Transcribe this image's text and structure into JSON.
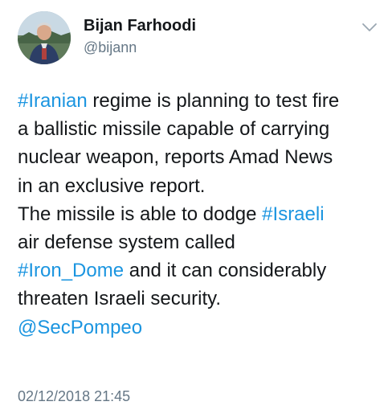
{
  "author": {
    "display_name": "Bijan Farhoodi",
    "handle": "@bijann"
  },
  "icons": {
    "avatar": "profile-photo",
    "menu": "chevron-down-icon"
  },
  "colors": {
    "link": "#1b95e0",
    "text": "#14171a",
    "muted": "#657786"
  },
  "tweet": {
    "lines": [
      [
        {
          "text": "#Iranian",
          "link": true
        },
        {
          "text": " regime is planning to test fire",
          "link": false
        }
      ],
      [
        {
          "text": "a ballistic missile capable of carrying",
          "link": false
        }
      ],
      [
        {
          "text": "nuclear weapon, reports Amad News",
          "link": false
        }
      ],
      [
        {
          "text": "in an exclusive report.",
          "link": false
        }
      ],
      [
        {
          "text": "The missile is able to dodge ",
          "link": false
        },
        {
          "text": "#Israeli",
          "link": true
        }
      ],
      [
        {
          "text": "air defense system called",
          "link": false
        }
      ],
      [
        {
          "text": "#Iron_Dome",
          "link": true
        },
        {
          "text": " and it can considerably",
          "link": false
        }
      ],
      [
        {
          "text": "threaten  Israeli security.",
          "link": false
        }
      ],
      [
        {
          "text": "@SecPompeo",
          "link": true
        }
      ]
    ],
    "timestamp": "02/12/2018 21:45"
  }
}
